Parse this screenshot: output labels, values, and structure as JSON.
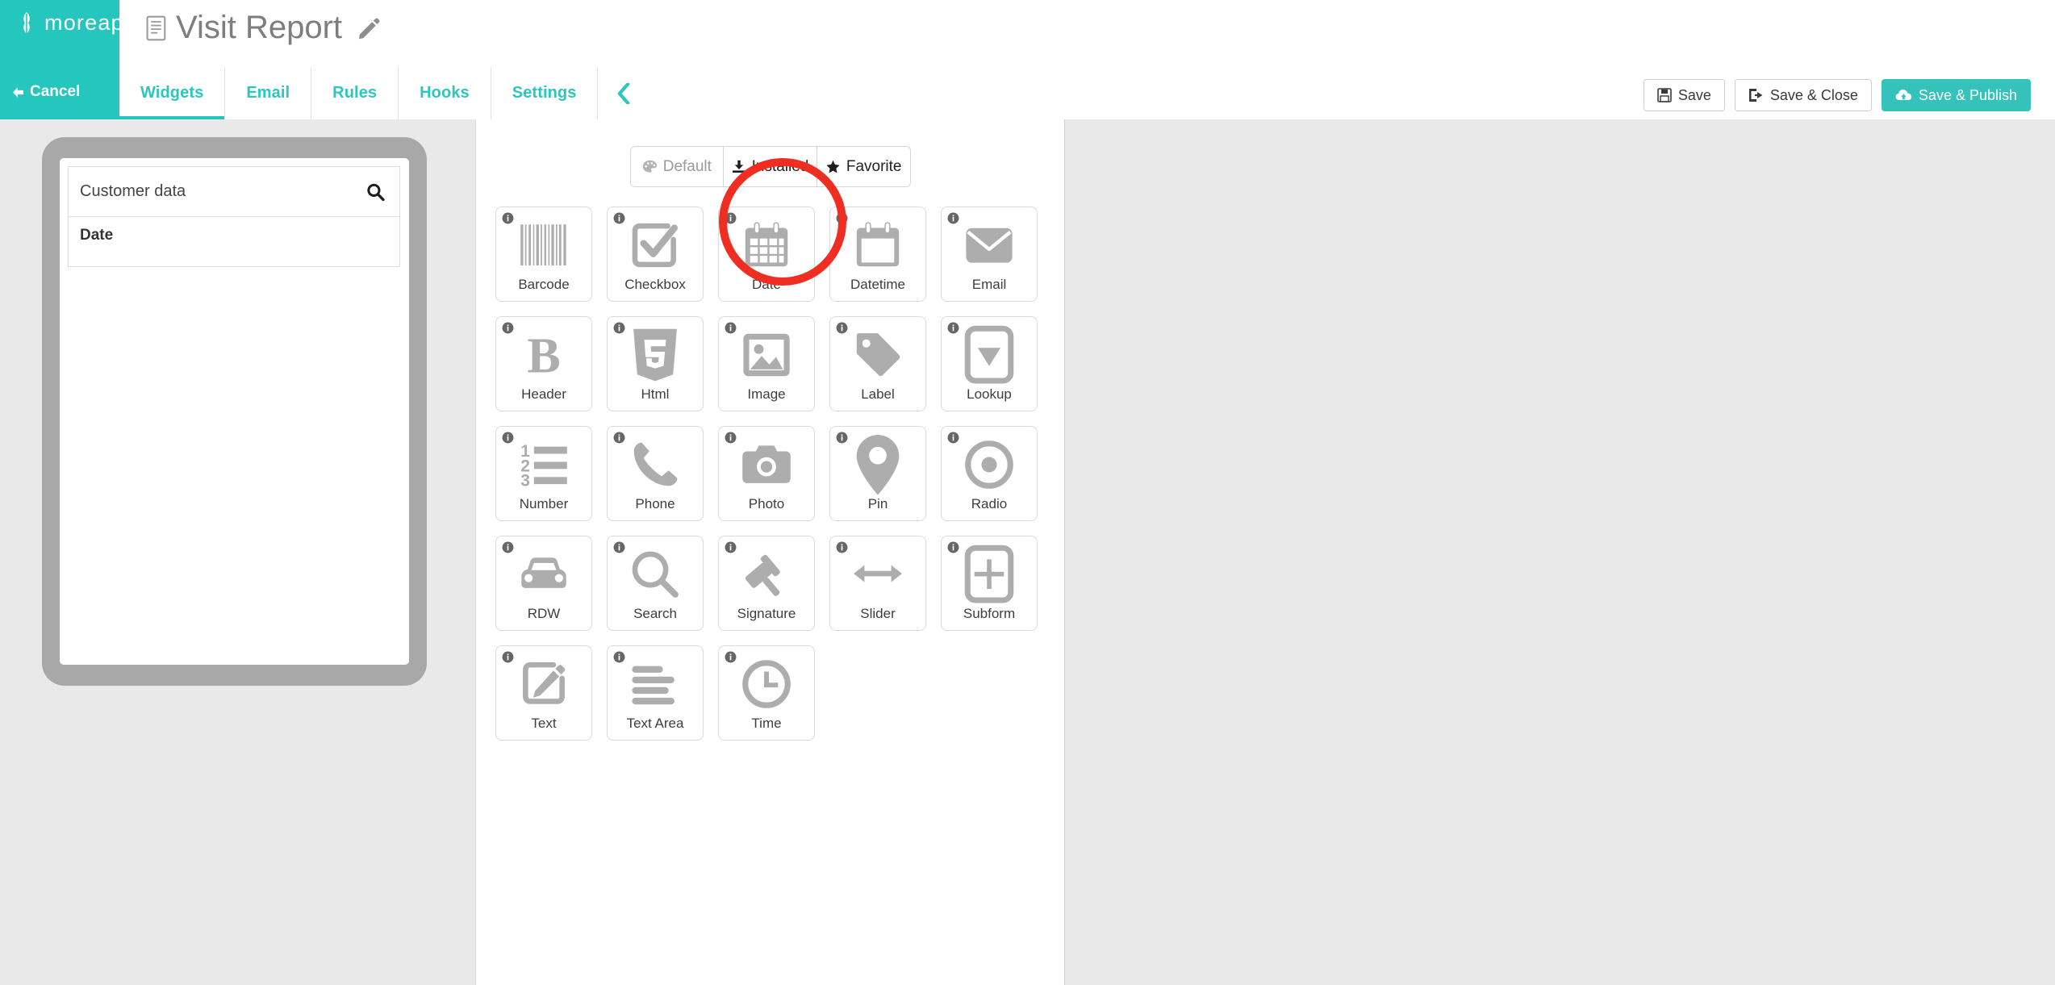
{
  "brand": {
    "name": "moreapp",
    "logo_icon": "wheat-leaf-icon"
  },
  "header": {
    "title": "Visit Report",
    "title_icon": "document-icon",
    "edit_icon": "pencil-icon",
    "cancel_label": "Cancel",
    "cancel_icon": "arrow-left-icon",
    "collapse_icon": "chevron-left-icon",
    "accent_color": "#25c6bd"
  },
  "tabs": [
    {
      "label": "Widgets",
      "active": true
    },
    {
      "label": "Email",
      "active": false
    },
    {
      "label": "Rules",
      "active": false
    },
    {
      "label": "Hooks",
      "active": false
    },
    {
      "label": "Settings",
      "active": false
    }
  ],
  "actions": [
    {
      "label": "Save",
      "icon": "floppy-disk-icon",
      "style": "default"
    },
    {
      "label": "Save & Close",
      "icon": "exit-icon",
      "style": "default"
    },
    {
      "label": "Save & Publish",
      "icon": "cloud-upload-icon",
      "style": "primary"
    }
  ],
  "preview": {
    "search_value": "Customer data",
    "search_icon": "magnifier-icon",
    "fields": [
      {
        "label": "Date"
      }
    ]
  },
  "widget_filters": [
    {
      "label": "Default",
      "icon": "palette-icon",
      "active": false
    },
    {
      "label": "Installed",
      "icon": "download-icon",
      "active": true
    },
    {
      "label": "Favorite",
      "icon": "star-icon",
      "active": false
    }
  ],
  "widgets": [
    {
      "label": "Barcode",
      "icon": "barcode-icon",
      "info_icon": "info-icon"
    },
    {
      "label": "Checkbox",
      "icon": "checkbox-icon",
      "info_icon": "info-icon"
    },
    {
      "label": "Date",
      "icon": "calendar-icon",
      "info_icon": "info-icon",
      "highlighted": true
    },
    {
      "label": "Datetime",
      "icon": "calendar-blank-icon",
      "info_icon": "info-icon"
    },
    {
      "label": "Email",
      "icon": "envelope-icon",
      "info_icon": "info-icon"
    },
    {
      "label": "Header",
      "icon": "bold-b-icon",
      "info_icon": "info-icon"
    },
    {
      "label": "Html",
      "icon": "html5-icon",
      "info_icon": "info-icon"
    },
    {
      "label": "Image",
      "icon": "picture-icon",
      "info_icon": "info-icon"
    },
    {
      "label": "Label",
      "icon": "tag-icon",
      "info_icon": "info-icon"
    },
    {
      "label": "Lookup",
      "icon": "dropdown-icon",
      "info_icon": "info-icon"
    },
    {
      "label": "Number",
      "icon": "numbered-list-icon",
      "info_icon": "info-icon"
    },
    {
      "label": "Phone",
      "icon": "phone-icon",
      "info_icon": "info-icon"
    },
    {
      "label": "Photo",
      "icon": "camera-icon",
      "info_icon": "info-icon"
    },
    {
      "label": "Pin",
      "icon": "map-pin-icon",
      "info_icon": "info-icon"
    },
    {
      "label": "Radio",
      "icon": "radio-button-icon",
      "info_icon": "info-icon"
    },
    {
      "label": "RDW",
      "icon": "car-icon",
      "info_icon": "info-icon"
    },
    {
      "label": "Search",
      "icon": "magnifier-icon",
      "info_icon": "info-icon"
    },
    {
      "label": "Signature",
      "icon": "gavel-icon",
      "info_icon": "info-icon"
    },
    {
      "label": "Slider",
      "icon": "arrows-horizontal-icon",
      "info_icon": "info-icon"
    },
    {
      "label": "Subform",
      "icon": "plus-square-icon",
      "info_icon": "info-icon"
    },
    {
      "label": "Text",
      "icon": "pencil-square-icon",
      "info_icon": "info-icon"
    },
    {
      "label": "Text Area",
      "icon": "text-lines-icon",
      "info_icon": "info-icon"
    },
    {
      "label": "Time",
      "icon": "clock-icon",
      "info_icon": "info-icon"
    }
  ],
  "annotation": {
    "type": "circle",
    "color": "#ef2d20",
    "target": "Date"
  }
}
